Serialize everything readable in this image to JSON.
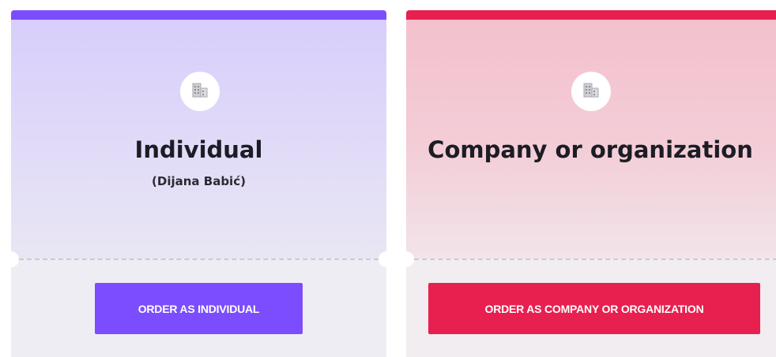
{
  "cards": [
    {
      "id": "individual",
      "icon": "building-icon",
      "accent_color": "#7c4dff",
      "title": "Individual",
      "subtitle": "(Dijana Babić)",
      "button_label": "ORDER AS INDIVIDUAL"
    },
    {
      "id": "company",
      "icon": "building-icon",
      "accent_color": "#e8204f",
      "title": "Company or organization",
      "subtitle": "",
      "button_label": "ORDER AS COMPANY OR ORGANIZATION"
    }
  ]
}
